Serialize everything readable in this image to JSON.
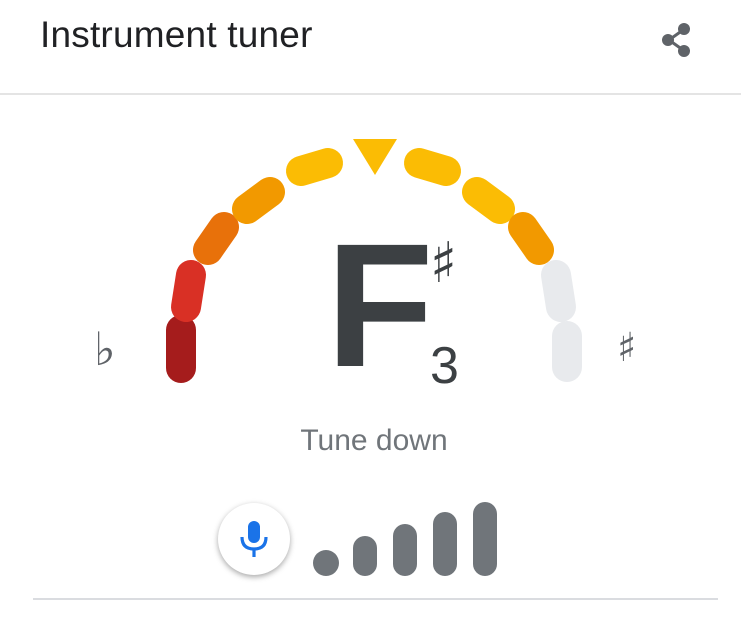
{
  "header": {
    "title": "Instrument tuner",
    "share_icon": "share-icon"
  },
  "tuner": {
    "note": "F",
    "accidental": "♯",
    "octave": "3",
    "status": "Tune down",
    "flat_symbol": "♭",
    "sharp_symbol": "♯",
    "segment_colors": [
      "#a51c1c",
      "#d93025",
      "#e8710a",
      "#f29900",
      "#fbbc04",
      "#fbbc04",
      "#fbbc04",
      "#f29900",
      "#e8eaed",
      "#e8eaed",
      "#e8eaed"
    ],
    "pointer_color": "#fbbc04",
    "mic_icon": "microphone-icon",
    "mic_color": "#1a73e8",
    "signal_level_bars": 5,
    "signal_level_active": 5
  }
}
